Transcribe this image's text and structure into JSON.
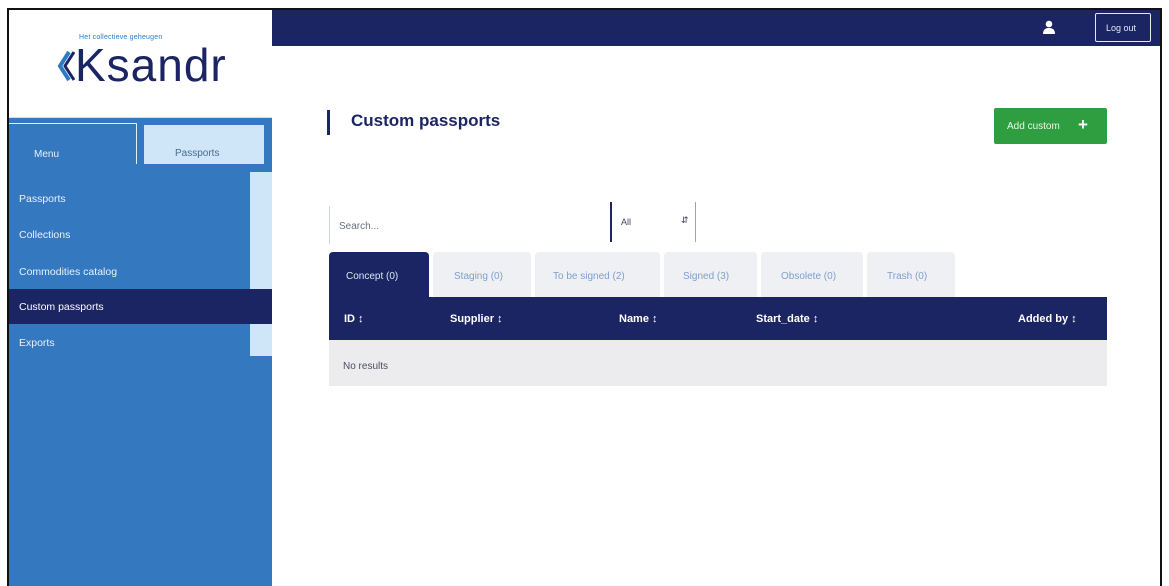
{
  "logo": {
    "tagline": "Het collectieve geheugen",
    "wordmark": "Ksandr"
  },
  "sidebar": {
    "tabs": [
      {
        "label": "Menu"
      },
      {
        "label": "Passports"
      }
    ],
    "items": [
      {
        "label": "Passports"
      },
      {
        "label": "Collections"
      },
      {
        "label": "Commodities catalog"
      },
      {
        "label": "Custom passports"
      },
      {
        "label": "Exports"
      }
    ],
    "active_item": "Custom passports"
  },
  "topbar": {
    "user_icon": "user-icon",
    "logout_label": "Log out"
  },
  "main": {
    "title": "Custom passports",
    "add_button": {
      "label": "Add custom",
      "icon": "plus-icon"
    },
    "search": {
      "placeholder": "Search..."
    },
    "filter": {
      "selected": "All"
    },
    "tabs": [
      {
        "label": "Concept (0)"
      },
      {
        "label": "Staging (0)"
      },
      {
        "label": "To be signed (2)"
      },
      {
        "label": "Signed (3)"
      },
      {
        "label": "Obsolete (0)"
      },
      {
        "label": "Trash (0)"
      }
    ],
    "table": {
      "columns": [
        "ID ↕",
        "Supplier ↕",
        "Name ↕",
        "Start_date ↕",
        "Added by ↕"
      ],
      "empty_text": "No results"
    }
  },
  "colors": {
    "navy": "#1b2563",
    "sidebar_blue": "#3479c0",
    "green": "#2f9e41"
  }
}
